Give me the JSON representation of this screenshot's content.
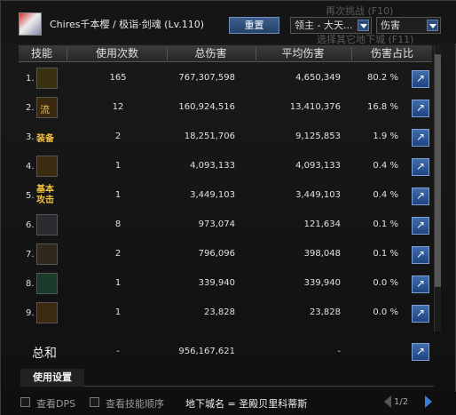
{
  "header": {
    "title": "Chires千本樱 / 极诣·剑魂 (Lv.110)",
    "reset_label": "重置",
    "target_select": "领主 - 大天...",
    "metric_select": "伤害",
    "bg_line1": "再次挑战",
    "bg_line2": "选择其它地下城",
    "bg_key1": "(F10)",
    "bg_key2": "(F11)"
  },
  "columns": [
    "技能",
    "使用次数",
    "总伤害",
    "平均伤害",
    "伤害占比"
  ],
  "rows": [
    {
      "idx": "1.",
      "skill": "",
      "uses": "165",
      "total": "767,307,598",
      "avg": "4,650,349",
      "pct": "80.2",
      "unit": "%"
    },
    {
      "idx": "2.",
      "skill": "流",
      "uses": "12",
      "total": "160,924,516",
      "avg": "13,410,376",
      "pct": "16.8",
      "unit": "%"
    },
    {
      "idx": "3.",
      "skill": "装备",
      "uses": "2",
      "total": "18,251,706",
      "avg": "9,125,853",
      "pct": "1.9",
      "unit": "%"
    },
    {
      "idx": "4.",
      "skill": "",
      "uses": "1",
      "total": "4,093,133",
      "avg": "4,093,133",
      "pct": "0.4",
      "unit": "%"
    },
    {
      "idx": "5.",
      "skill": "基本攻击",
      "uses": "1",
      "total": "3,449,103",
      "avg": "3,449,103",
      "pct": "0.4",
      "unit": "%"
    },
    {
      "idx": "6.",
      "skill": "",
      "uses": "8",
      "total": "973,074",
      "avg": "121,634",
      "pct": "0.1",
      "unit": "%"
    },
    {
      "idx": "7.",
      "skill": "",
      "uses": "2",
      "total": "796,096",
      "avg": "398,048",
      "pct": "0.1",
      "unit": "%"
    },
    {
      "idx": "8.",
      "skill": "",
      "uses": "1",
      "total": "339,940",
      "avg": "339,940",
      "pct": "0.0",
      "unit": "%"
    },
    {
      "idx": "9.",
      "skill": "",
      "uses": "1",
      "total": "23,828",
      "avg": "23,828",
      "pct": "0.0",
      "unit": "%"
    }
  ],
  "total": {
    "label": "总和",
    "uses": "-",
    "total": "956,167,621",
    "avg": "-"
  },
  "settings": {
    "tab_label": "使用设置"
  },
  "footer": {
    "check_dps": "查看DPS",
    "check_order": "查看技能顺序",
    "dungeon": "地下城名 = 圣殿贝里科蒂斯",
    "page": "1/2"
  }
}
